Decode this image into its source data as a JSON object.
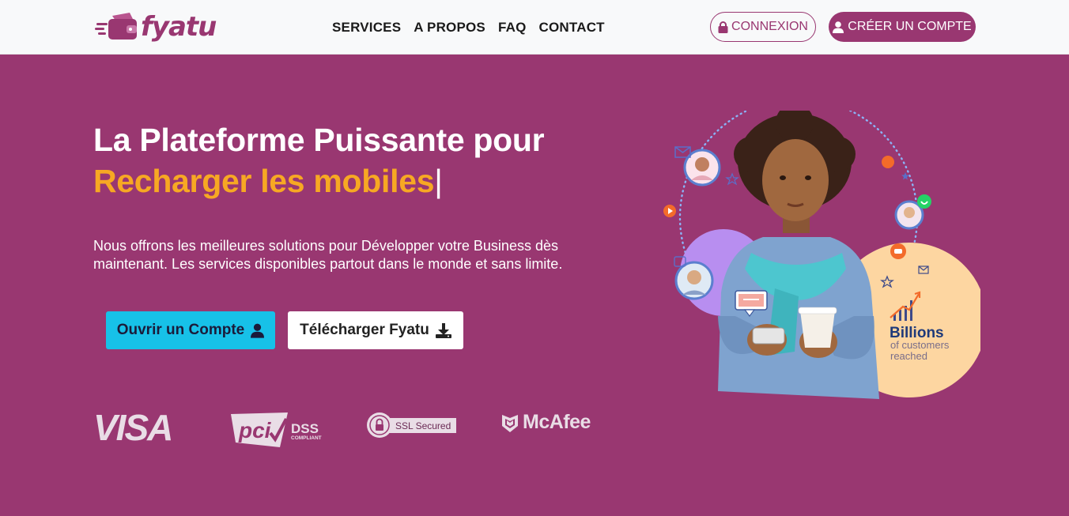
{
  "brand": {
    "name": "fyatu",
    "primary_color": "#993771",
    "accent_color": "#f7a823",
    "cta_color": "#17c1e8"
  },
  "nav": {
    "links": [
      "SERVICES",
      "A PROPOS",
      "FAQ",
      "CONTACT"
    ],
    "login_label": "CONNEXION",
    "login_icon": "lock-icon",
    "register_label": "CRÉER UN COMPTE",
    "register_icon": "user-icon"
  },
  "hero": {
    "title_line1": "La Plateforme Puissante pour",
    "title_line2": "Recharger les mobiles",
    "caret": "|",
    "description": "Nous offrons les meilleures solutions pour Développer votre Business dès maintenant. Les services disponibles partout dans le monde et sans limite.",
    "open_account_label": "Ouvrir un Compte",
    "open_account_icon": "user-icon",
    "download_label": "Télécharger Fyatu",
    "download_icon": "download-icon"
  },
  "trust_logos": {
    "visa": "VISA",
    "pci": "PCI DSS COMPLIANT",
    "ssl": "SSL Secured",
    "mcafee": "McAfee"
  },
  "illustration": {
    "badge_title": "Billions",
    "badge_subtitle": "of customers reached"
  }
}
